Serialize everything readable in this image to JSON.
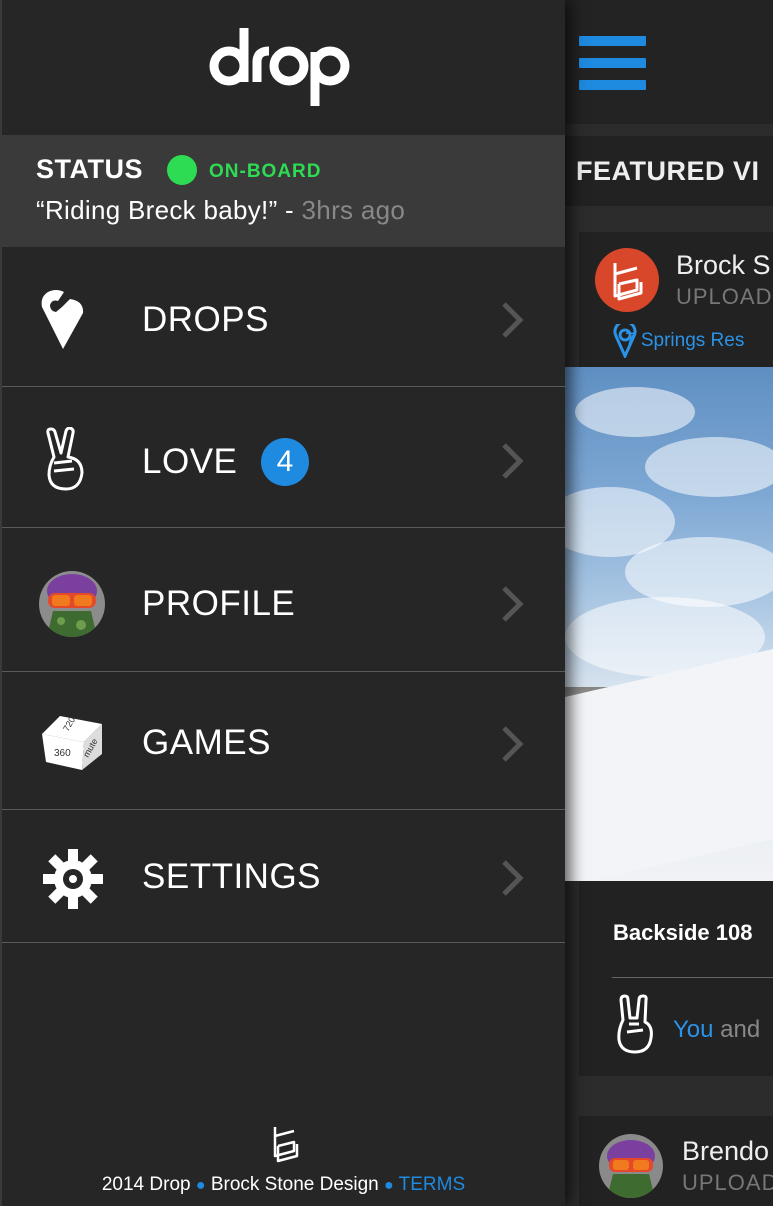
{
  "drawer": {
    "logo_text": "drop",
    "status": {
      "label": "STATUS",
      "state": "ON-BOARD",
      "message": "“Riding Breck baby!” - ",
      "time_ago": "3hrs ago",
      "state_color": "#2ddc52"
    },
    "menu": [
      {
        "label": "DROPS",
        "icon": "drop-pin-icon"
      },
      {
        "label": "LOVE",
        "icon": "peace-hand-icon",
        "badge": "4"
      },
      {
        "label": "PROFILE",
        "icon": "profile-avatar"
      },
      {
        "label": "GAMES",
        "icon": "dice-cube-icon"
      },
      {
        "label": "SETTINGS",
        "icon": "gear-icon"
      }
    ],
    "footer": {
      "year_brand": "2014 Drop",
      "designer": "Brock Stone Design",
      "terms": "TERMS"
    }
  },
  "content": {
    "section_title": "FEATURED VI",
    "card1": {
      "user": "Brock S",
      "upload": "UPLOAD",
      "location": "7 Springs Res",
      "caption": "Backside 108",
      "love_you": "You",
      "love_rest": " and"
    },
    "card2": {
      "user": "Brendo",
      "upload": "UPLOAD"
    }
  },
  "colors": {
    "accent": "#1e8ae0",
    "status_green": "#2ddc52",
    "drawer_bg": "#262626",
    "status_bg": "#3a3a3a"
  }
}
